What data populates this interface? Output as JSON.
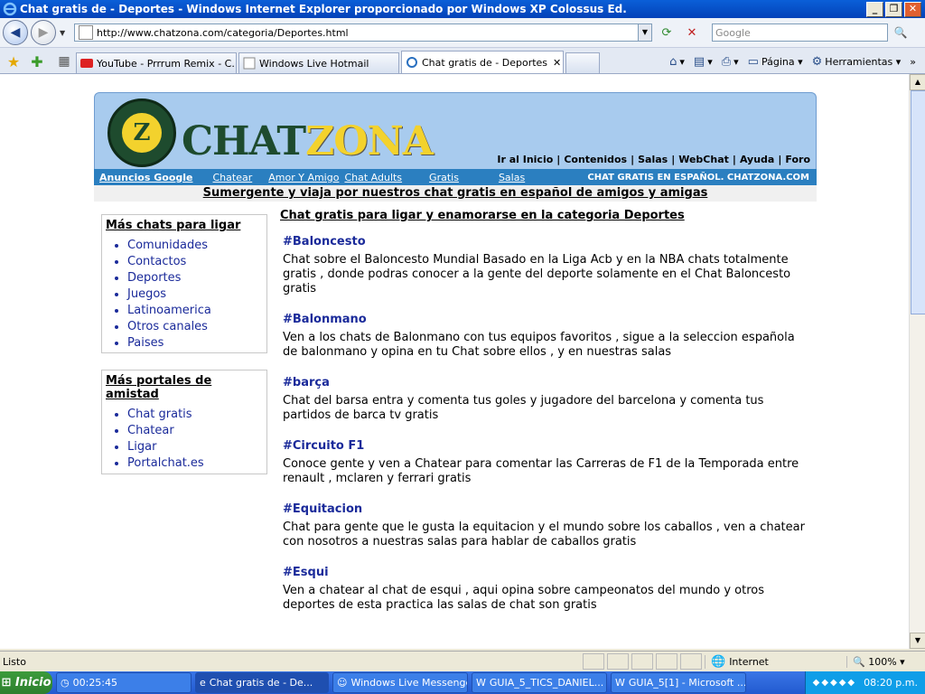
{
  "window": {
    "title": "Chat gratis de - Deportes - Windows Internet Explorer proporcionado por Windows XP Colossus Ed."
  },
  "address": {
    "url": "http://www.chatzona.com/categoria/Deportes.html",
    "search_placeholder": "Google"
  },
  "tabs": [
    {
      "label": "YouTube - Prrrum Remix - C..."
    },
    {
      "label": "Windows Live Hotmail"
    },
    {
      "label": "Chat gratis de - Deportes"
    }
  ],
  "commandbar": {
    "page": "Página",
    "tools": "Herramientas"
  },
  "site": {
    "logo_part1": "CHAT",
    "logo_part2": "ZONA",
    "logo_badge": "Z",
    "topnav": [
      "Ir al Inicio",
      "Contenidos",
      "Salas",
      "WebChat",
      "Ayuda",
      "Foro"
    ],
    "menubar": {
      "items": [
        "Anuncios Google",
        "Chatear",
        "Amor Y Amigo",
        "Chat Adults",
        "Gratis",
        "Salas"
      ],
      "right": "CHAT GRATIS EN ESPAÑOL. CHATZONA.COM"
    },
    "tagline": "Sumergente y viaja por nuestros chat gratis en español de amigos y amigas"
  },
  "sidebar": {
    "box1_title": "Más chats para ligar",
    "box1_items": [
      "Comunidades",
      "Contactos",
      "Deportes",
      "Juegos",
      "Latinoamerica",
      "Otros canales",
      "Paises"
    ],
    "box2_title": "Más portales de amistad",
    "box2_items": [
      "Chat gratis",
      "Chatear",
      "Ligar",
      "Portalchat.es"
    ]
  },
  "main": {
    "heading": "Chat gratis para ligar y enamorarse en la categoria Deportes",
    "entries": [
      {
        "title": "#Baloncesto",
        "desc": "Chat sobre el Baloncesto Mundial Basado en la Liga Acb y en la NBA chats totalmente gratis , donde podras conocer a la gente del deporte solamente en el Chat Baloncesto gratis"
      },
      {
        "title": "#Balonmano",
        "desc": "Ven a los chats de Balonmano con tus equipos favoritos , sigue a la seleccion española de balonmano y opina en tu Chat sobre ellos , y en nuestras salas"
      },
      {
        "title": "#barça",
        "desc": "Chat del barsa entra y comenta tus goles y jugadore del barcelona y comenta tus partidos de barca tv gratis"
      },
      {
        "title": "#Circuito F1",
        "desc": "Conoce gente y ven a Chatear para comentar las Carreras de F1 de la Temporada entre renault , mclaren y ferrari gratis"
      },
      {
        "title": "#Equitacion",
        "desc": "Chat para gente que le gusta la equitacion y el mundo sobre los caballos , ven a chatear con nosotros a nuestras salas para hablar de caballos gratis"
      },
      {
        "title": "#Esqui",
        "desc": "Ven a chatear al chat de esqui , aqui opina sobre campeonatos del mundo y otros deportes de esta practica las salas de chat son gratis"
      }
    ]
  },
  "status": {
    "text": "Listo",
    "zone": "Internet",
    "zoom": "100%"
  },
  "taskbar": {
    "start": "Inicio",
    "items": [
      "00:25:45",
      "Chat gratis de - De...",
      "Windows Live Messenger",
      "GUIA_5_TICS_DANIEL...",
      "GUIA_5[1] - Microsoft ..."
    ],
    "clock": "08:20 p.m."
  }
}
